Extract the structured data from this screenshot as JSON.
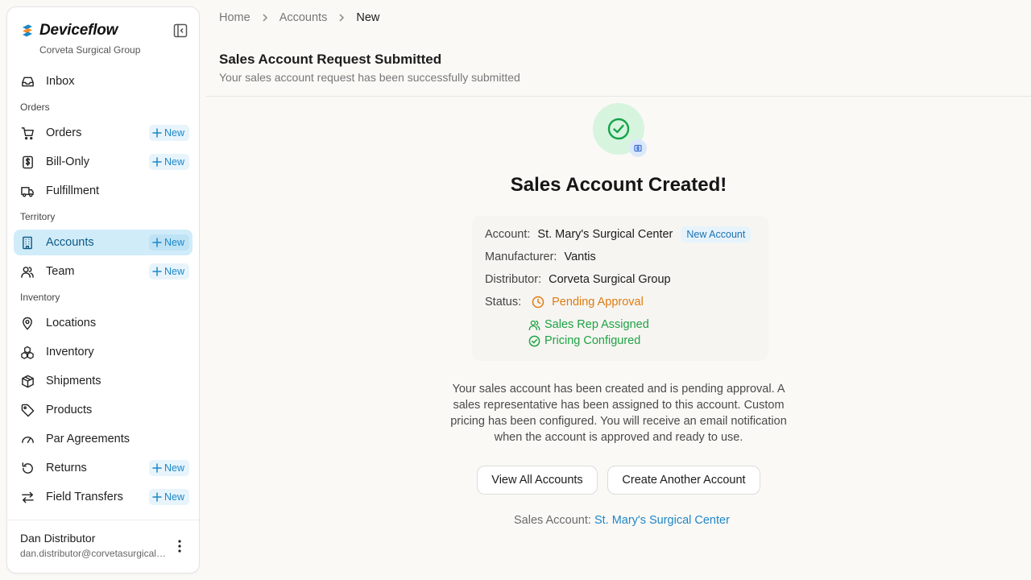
{
  "sidebar": {
    "brand": "Deviceflow",
    "org": "Corveta Surgical Group",
    "new_label": "New",
    "items": [
      {
        "label": "Inbox"
      },
      {
        "section": "Orders"
      },
      {
        "label": "Orders"
      },
      {
        "label": "Bill-Only"
      },
      {
        "label": "Fulfillment"
      },
      {
        "section": "Territory"
      },
      {
        "label": "Accounts"
      },
      {
        "label": "Team"
      },
      {
        "section": "Inventory"
      },
      {
        "label": "Locations"
      },
      {
        "label": "Inventory"
      },
      {
        "label": "Shipments"
      },
      {
        "label": "Products"
      },
      {
        "label": "Par Agreements"
      },
      {
        "label": "Returns"
      },
      {
        "label": "Field Transfers"
      }
    ],
    "user": {
      "name": "Dan Distributor",
      "email": "dan.distributor@corvetasurgicalgroup.com"
    }
  },
  "breadcrumb": [
    "Home",
    "Accounts",
    "New"
  ],
  "header": {
    "title": "Sales Account Request Submitted",
    "subtitle": "Your sales account request has been successfully submitted"
  },
  "main": {
    "headline": "Sales Account Created!",
    "details": {
      "account_label": "Account:",
      "account_value": "St. Mary's Surgical Center",
      "account_badge": "New Account",
      "manufacturer_label": "Manufacturer:",
      "manufacturer_value": "Vantis",
      "distributor_label": "Distributor:",
      "distributor_value": "Corveta Surgical Group",
      "status_label": "Status:",
      "status_value": "Pending Approval",
      "rep_assigned": "Sales Rep Assigned",
      "pricing_configured": "Pricing Configured"
    },
    "message": "Your sales account has been created and is pending approval. A sales representative has been assigned to this account. Custom pricing has been configured. You will receive an email notification when the account is approved and ready to use.",
    "buttons": {
      "view_all": "View All Accounts",
      "create_another": "Create Another Account"
    },
    "footer_label": "Sales Account:",
    "footer_link": "St. Mary's Surgical Center"
  },
  "colors": {
    "accent": "#1b88c8",
    "active_bg": "#d1ecf9",
    "success": "#1ea345",
    "pending": "#e07b12"
  }
}
